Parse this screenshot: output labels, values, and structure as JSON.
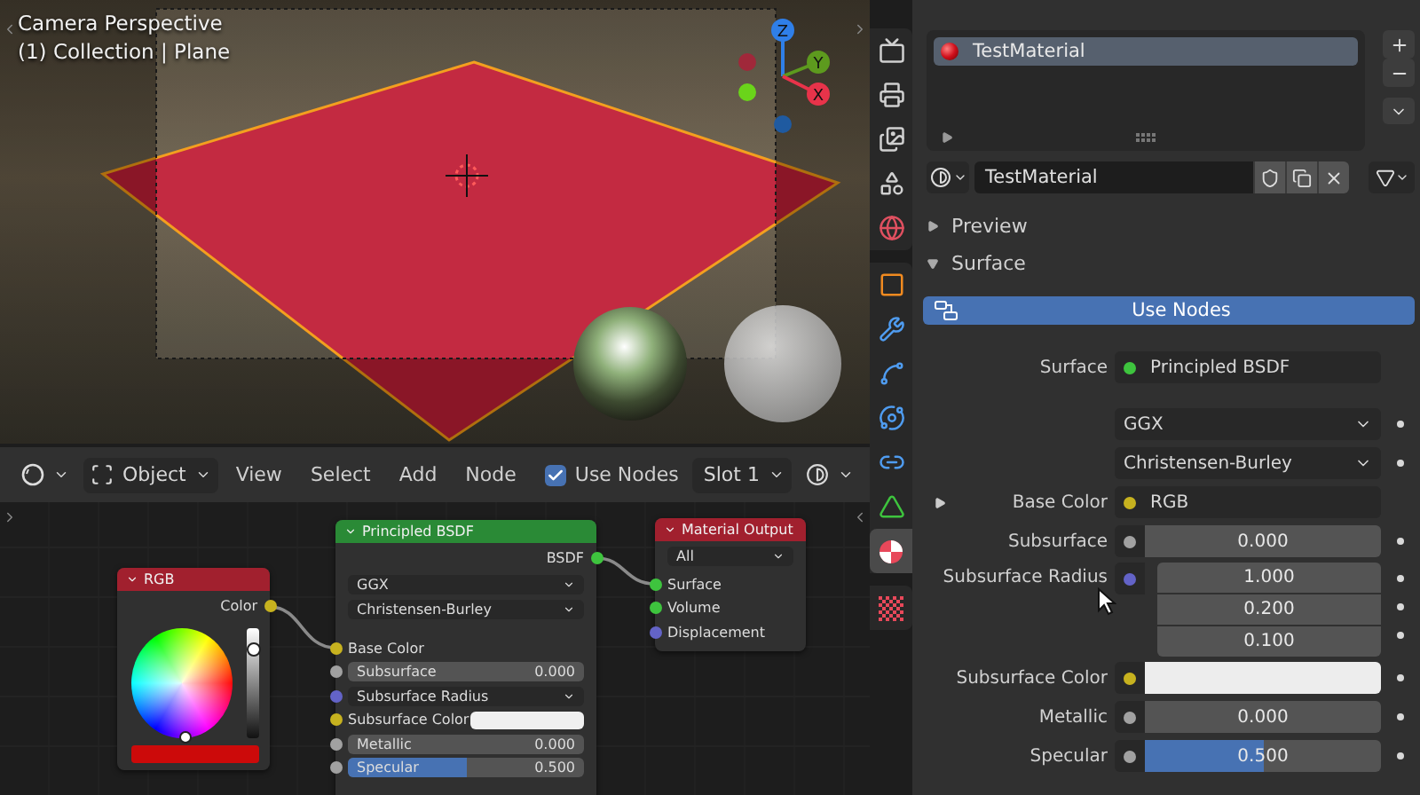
{
  "viewport": {
    "overlay": [
      "Camera Perspective",
      "(1) Collection | Plane"
    ],
    "gizmo": [
      {
        "kind": "z",
        "label": "Z"
      },
      {
        "kind": "y",
        "label": "Y"
      },
      {
        "kind": "x",
        "label": "X"
      }
    ]
  },
  "node_header": {
    "mode": "Object",
    "menus": [
      "View",
      "Select",
      "Add",
      "Node"
    ],
    "use_nodes": {
      "label": "Use Nodes",
      "checked": true
    },
    "slot": "Slot 1"
  },
  "node_editor": {
    "nodes": [
      {
        "kind": "rgb",
        "title": "RGB",
        "outputs": [
          {
            "label": "Color",
            "color": "#c7b21f"
          }
        ],
        "level": 0.8
      },
      {
        "kind": "principled",
        "title": "Principled BSDF",
        "outputs": [
          {
            "label": "BSDF",
            "color": "#3ec43e"
          }
        ],
        "inputs": [
          {
            "kind": "dropdown",
            "label": "GGX"
          },
          {
            "kind": "dropdown",
            "label": "Christensen-Burley"
          },
          {
            "kind": "socket",
            "label": "Base Color",
            "color": "#c7b21f"
          },
          {
            "kind": "slider",
            "label": "Subsurface",
            "value": "0.000",
            "level": 0,
            "color": "#a1a1a1"
          },
          {
            "kind": "menu",
            "label": "Subsurface Radius",
            "color": "#6363c7"
          },
          {
            "kind": "color",
            "label": "Subsurface Color",
            "color": "#c7b21f"
          },
          {
            "kind": "slider",
            "label": "Metallic",
            "value": "0.000",
            "level": 0,
            "color": "#a1a1a1"
          },
          {
            "kind": "slider",
            "label": "Specular",
            "value": "0.500",
            "level": 0.5,
            "color": "#a1a1a1"
          }
        ]
      },
      {
        "kind": "output",
        "title": "Material Output",
        "inputs": [
          {
            "kind": "dropdown",
            "label": "All"
          },
          {
            "kind": "socket",
            "label": "Surface",
            "color": "#3ec43e"
          },
          {
            "kind": "socket",
            "label": "Volume",
            "color": "#3ec43e"
          },
          {
            "kind": "socket",
            "label": "Displacement",
            "color": "#6363c7"
          }
        ]
      }
    ]
  },
  "properties": {
    "tab_groups": [
      [
        {
          "kind": "render",
          "selected": false
        },
        {
          "kind": "output",
          "selected": false
        },
        {
          "kind": "view_layer",
          "selected": false
        },
        {
          "kind": "scene",
          "selected": false
        },
        {
          "kind": "world",
          "selected": false
        }
      ],
      [
        {
          "kind": "object",
          "selected": false
        },
        {
          "kind": "modifier",
          "selected": false
        },
        {
          "kind": "particles",
          "selected": false
        },
        {
          "kind": "physics",
          "selected": false
        },
        {
          "kind": "constraints",
          "selected": false
        },
        {
          "kind": "data",
          "selected": false
        },
        {
          "kind": "material",
          "selected": true
        }
      ],
      [
        {
          "kind": "texture",
          "selected": false
        }
      ]
    ],
    "slots": [
      {
        "name": "TestMaterial",
        "selected": true
      }
    ],
    "material_name": "TestMaterial",
    "panels": [
      {
        "title": "Preview",
        "expanded": false
      },
      {
        "title": "Surface",
        "expanded": true
      }
    ],
    "use_nodes_button": "Use Nodes",
    "surface": {
      "label": "Surface",
      "value": "Principled BSDF",
      "color": "#3ec43e"
    },
    "inputs": [
      {
        "kind": "dropdown",
        "value": "GGX"
      },
      {
        "kind": "dropdown",
        "value": "Christensen-Burley"
      },
      {
        "kind": "link",
        "label": "Base Color",
        "value": "RGB",
        "color": "#c7b21f",
        "expanded": false
      },
      {
        "kind": "slider",
        "label": "Subsurface",
        "value": "0.000",
        "level": 0,
        "color": "#a1a1a1"
      },
      {
        "kind": "vector",
        "label": "Subsurface Radius",
        "values": [
          "1.000",
          "0.200",
          "0.100"
        ],
        "color": "#6363c7"
      },
      {
        "kind": "color",
        "label": "Subsurface Color",
        "color": "#c7b21f"
      },
      {
        "kind": "slider",
        "label": "Metallic",
        "value": "0.000",
        "level": 0,
        "color": "#a1a1a1"
      },
      {
        "kind": "slider",
        "label": "Specular",
        "value": "0.500",
        "level": 0.5,
        "color": "#a1a1a1"
      }
    ]
  }
}
